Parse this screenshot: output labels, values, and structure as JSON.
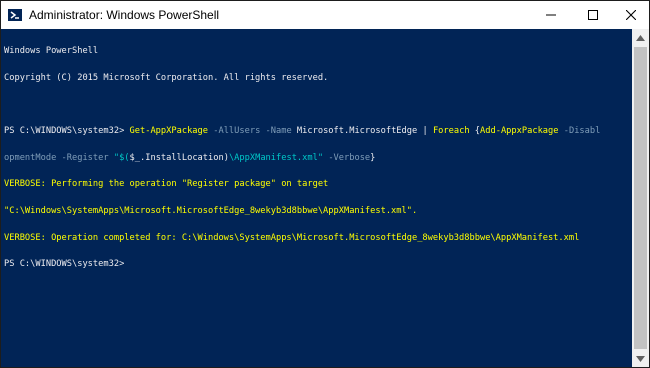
{
  "window": {
    "title": "Administrator: Windows PowerShell",
    "icon": "powershell-icon",
    "controls": {
      "minimize": "minimize-icon",
      "maximize": "maximize-icon",
      "close": "close-icon"
    }
  },
  "colors": {
    "console_bg": "#012456",
    "text": "#eeedf0",
    "cmdlet": "#ffff00",
    "parameter": "#7f9db8",
    "string": "#00c8c8",
    "verbose": "#ffff00"
  },
  "console": {
    "header": [
      "Windows PowerShell",
      "Copyright (C) 2015 Microsoft Corporation. All rights reserved."
    ],
    "prompt1": "PS C:\\WINDOWS\\system32> ",
    "cmd": {
      "cmdlet1": "Get-AppXPackage",
      "param1": " -AllUsers -Name ",
      "arg1": "Microsoft.MicrosoftEdge",
      "pipe": " | ",
      "foreach": "Foreach",
      "brace_open": " {",
      "cmdlet2": "Add-AppxPackage",
      "param2": " -Disabl",
      "param2_cont": "opmentMode -Register ",
      "subexpr_open": "\"$(",
      "var": "$_",
      "prop": ".InstallLocation)",
      "path": "\\AppXManifest.xml\"",
      "param3": " -Verbose",
      "brace_close": "}"
    },
    "verbose": [
      "VERBOSE: Performing the operation \"Register package\" on target",
      "\"C:\\Windows\\SystemApps\\Microsoft.MicrosoftEdge_8wekyb3d8bbwe\\AppXManifest.xml\".",
      "VERBOSE: Operation completed for: C:\\Windows\\SystemApps\\Microsoft.MicrosoftEdge_8wekyb3d8bbwe\\AppXManifest.xml"
    ],
    "prompt2": "PS C:\\WINDOWS\\system32> "
  },
  "scrollbar": {
    "up": "scroll-up-arrow-icon",
    "down": "scroll-down-arrow-icon"
  }
}
